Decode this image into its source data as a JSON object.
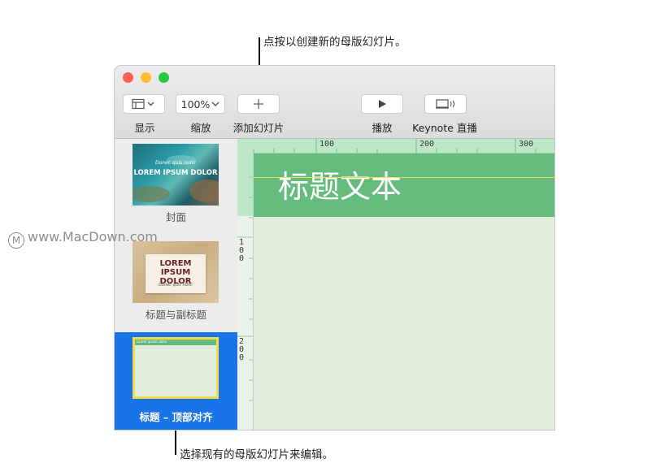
{
  "callouts": {
    "top": "点按以创建新的母版幻灯片。",
    "bottom": "选择现有的母版幻灯片来编辑。"
  },
  "watermark": "www.MacDown.com",
  "toolbar": {
    "view": {
      "label": "显示",
      "icon": "view-icon"
    },
    "zoom": {
      "label": "缩放",
      "value": "100%"
    },
    "add_master": {
      "label": "添加幻灯片",
      "icon": "plus-icon"
    },
    "play": {
      "label": "播放",
      "icon": "play-icon"
    },
    "keynote_live": {
      "label": "Keynote 直播",
      "icon": "keynote-live-icon"
    }
  },
  "navigator": {
    "items": [
      {
        "label": "封面",
        "thumb_title": "LOREM IPSUM DOLOR",
        "thumb_subtitle": "Donec quis nunc"
      },
      {
        "label": "标题与副标题",
        "thumb_title": "LOREM IPSUM DOLOR",
        "thumb_subtitle": "Donec quis nunc"
      },
      {
        "label": "标题 – 顶部对齐",
        "thumb_title": "Lorem ipsum dolor",
        "selected": true
      }
    ]
  },
  "rulers": {
    "horizontal": [
      "100",
      "200",
      "300"
    ],
    "vertical": [
      "100",
      "200"
    ]
  },
  "slide": {
    "title": "标题文本"
  },
  "colors": {
    "selection": "#1a73e8",
    "title_band": "#64bb7d",
    "slide_bg": "#e2eedd"
  }
}
